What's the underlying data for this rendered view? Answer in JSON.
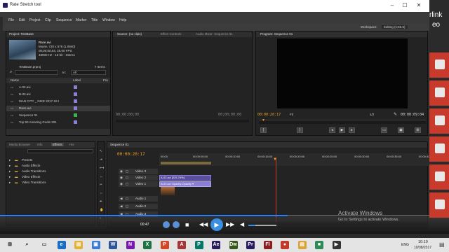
{
  "window": {
    "title": "Rate Stretch tool",
    "minimize": "–",
    "maximize": "☐",
    "close": "✕"
  },
  "menu": [
    "File",
    "Edit",
    "Project",
    "Clip",
    "Sequence",
    "Marker",
    "Title",
    "Window",
    "Help"
  ],
  "workspace": {
    "label": "Workspace:",
    "value": "Editing (CS5.5)"
  },
  "overlay_text": {
    "line1": "rlink",
    "line2": "eo"
  },
  "project": {
    "tab": "Project: TestBase",
    "clip_name": "Race.avi",
    "clip_info1": "Movie, 720 x 576 (1.0940)",
    "clip_info2": "00;00;00;03, 25.00 FPS",
    "clip_info3": "48000 Hz - 16-bit - Stereo",
    "project_file": "TestBase.prproj",
    "item_count": "7 Items",
    "in_label": "In:",
    "in_value": "All",
    "col_name": "Name",
    "col_label": "Label",
    "col_fr": "Fra",
    "items": [
      {
        "name": "A-02.avi",
        "color": "#8a7fd6"
      },
      {
        "name": "B-03.avi",
        "color": "#8a7fd6"
      },
      {
        "name": "MAN CITY _ NIKE 2017-18 I",
        "color": "#8a7fd6"
      },
      {
        "name": "Race.avi",
        "color": "#8a7fd6"
      },
      {
        "name": "Sequence 01",
        "color": "#3cb44b"
      },
      {
        "name": "Top 50 Amazing Goals 201",
        "color": "#8a7fd6"
      }
    ]
  },
  "source_tabs": [
    "Source: (no clips)",
    "Effect Controls",
    "Audio Mixer: Sequence 01"
  ],
  "source_tc": "00;00;00;00",
  "source_tc2": "00;00;00;00",
  "program": {
    "tab": "Program: Sequence 01",
    "tc_left": "00:00:20:17",
    "fit": "Fit",
    "ratio": "1/2",
    "tc_right": "00:00:09:04"
  },
  "effects": {
    "tabs": [
      "Media Browser",
      "Info",
      "Effects",
      "His"
    ],
    "folders": [
      "Presets",
      "Audio Effects",
      "Audio Transitions",
      "Video Effects",
      "Video Transitions"
    ]
  },
  "timeline": {
    "tab": "Sequence 01",
    "tc": "00:00:20:17",
    "ruler": [
      "00:00",
      "00:00:05:00",
      "00:00:10:00",
      "00:00:15:00",
      "00:00:20:00",
      "00:00:25:00",
      "00:00:30:00",
      "00:00:35:00",
      "00:00:40:00"
    ],
    "tracks": [
      {
        "name": "Video 3"
      },
      {
        "name": "Video 2"
      },
      {
        "name": "Video 1"
      },
      {
        "name": "Audio 1"
      },
      {
        "name": "Audio 2"
      },
      {
        "name": "Audio 3"
      }
    ],
    "clip_v2": "A-02.avi [225.76%]",
    "clip_v1": "B-03.avi Opacity:Opacity ▾"
  },
  "player": {
    "time": "00:47"
  },
  "watermark": {
    "line1": "Activate Windows",
    "line2": "Go to Settings to activate Windows."
  },
  "tray": {
    "time": "10:19",
    "date": "10/08/2017",
    "lang": "ENG"
  },
  "taskbar_icons": [
    {
      "name": "windows-start-icon",
      "glyph": "⊞",
      "color": "#1a1a1a"
    },
    {
      "name": "search-icon",
      "glyph": "⌕",
      "color": "#333333"
    },
    {
      "name": "task-view-icon",
      "glyph": "▭",
      "color": "#333333"
    },
    {
      "name": "edge-icon",
      "glyph": "e",
      "color": "#1a6fc4"
    },
    {
      "name": "explorer-icon",
      "glyph": "▤",
      "color": "#e2b13c"
    },
    {
      "name": "store-icon",
      "glyph": "▣",
      "color": "#3a7bd5"
    },
    {
      "name": "word-icon",
      "glyph": "W",
      "color": "#2b579a"
    },
    {
      "name": "onenote-icon",
      "glyph": "N",
      "color": "#7719aa"
    },
    {
      "name": "excel-icon",
      "glyph": "X",
      "color": "#217346"
    },
    {
      "name": "powerpoint-icon",
      "glyph": "P",
      "color": "#d24726"
    },
    {
      "name": "access-icon",
      "glyph": "A",
      "color": "#a4373a"
    },
    {
      "name": "publisher-icon",
      "glyph": "P",
      "color": "#077568"
    },
    {
      "name": "aftereffects-icon",
      "glyph": "Ae",
      "color": "#2a1a5e"
    },
    {
      "name": "dreamweaver-icon",
      "glyph": "Dw",
      "color": "#35591b"
    },
    {
      "name": "premiere-icon",
      "glyph": "Pr",
      "color": "#2a1a5e"
    },
    {
      "name": "flash-icon",
      "glyph": "Fl",
      "color": "#8a1e1e"
    },
    {
      "name": "app-icon-red",
      "glyph": "●",
      "color": "#c0392b"
    },
    {
      "name": "app-icon-folder",
      "glyph": "▤",
      "color": "#d9a53a"
    },
    {
      "name": "app-icon-green",
      "glyph": "■",
      "color": "#2e8b57"
    },
    {
      "name": "app-icon-player",
      "glyph": "▶",
      "color": "#333333"
    }
  ]
}
